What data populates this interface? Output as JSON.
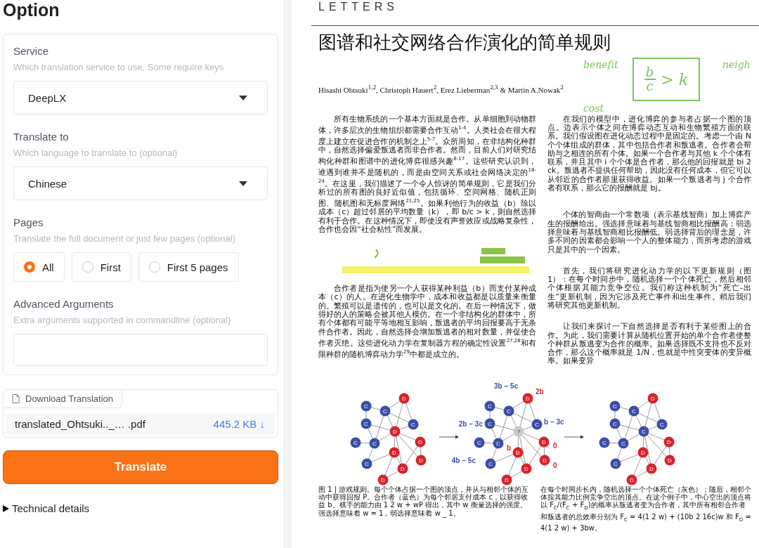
{
  "panel": {
    "title": "Option",
    "fields": [
      {
        "kind": "dropdown",
        "label": "Service",
        "hint": "Which translation service to use. Some require keys",
        "value": "DeepLX"
      },
      {
        "kind": "dropdown",
        "label": "Translate to",
        "hint": "Which language to translate to (optional)",
        "value": "Chinese"
      },
      {
        "kind": "radio",
        "label": "Pages",
        "hint": "Translate the full document or just few pages (optional)",
        "options": [
          {
            "label": "All",
            "selected": true
          },
          {
            "label": "First",
            "selected": false
          },
          {
            "label": "First 5 pages",
            "selected": false
          }
        ]
      },
      {
        "kind": "textbox",
        "label": "Advanced Arguments",
        "hint": "Extra arguments supported in commandline (optional)"
      }
    ]
  },
  "download": {
    "label": "Download Translation",
    "file_name": "translated_Ohtsuki.._… .pdf",
    "file_size": "445.2 KB",
    "download_glyph": "↓"
  },
  "translate_button": "Translate",
  "technical_details": {
    "label": "Technical details",
    "expanded": false
  },
  "document": {
    "journal_header": "LETTERS",
    "title": "图谱和社交网络合作演化的简单规则",
    "authors": "Hisashi Ohtsuki$^{1,2}$, Christoph Hauert$^{2}$, Erez Lieberman$^{2,3}$ & Martin A.Nowak$^{2}$",
    "left_column": [
      "所有生物系统的一个基本方面就是合作。从单细胞到动物群体，许多层次的生物组织都需要合作互动$^{1-4}$。人类社会在很大程度上建立在促进合作的机制之上$^{5-7}$。众所周知，在非结构化种群中，自然选择偏爱叛逃者而非合作者。然而，目前人们对研究结构化种群和图谱中的进化博弈很感兴趣$^{8-17}$。这些研究认识到，谁遇到谁并不是随机的，而是由空间关系或社会网络决定的$^{18-24}$。在这里，我们描述了一个令人惊讶的简单规则，它是我们分析过的所有图的良好近似值，包括循环、空间网格、随机正则图、随机图和无标度网络$^{21,25}$。如果利他行为的收益（b）除以成本（c）超过邻居的平均数量（k），即 b/c > k，则自然选择有利于合作。在这种情况下，即使没有声誉效应或战略复杂性，合作也会因“社会粘性”而发展。",
      "合作者是指为使另一个人获得某种利益（b）而支付某种成本（c）的人。在进化生物学中，成本和收益都是以质量来衡量的。繁殖可以是遗传的，也可以是文化的。在后一种情况下，做得好的人的策略会被其他人模仿。在一个非结构化的群体中，所有个体都有可能平等地相互影响，叛逃者的平均回报要高于无条件合作者。因此，自然选择会增加叛逃者的相对数量，并促使合作者灭绝。这些进化动力学在复制器方程的确定性设置$^{27,28}$和有限种群的随机博弈动力学$^{29}$中都是成立的。"
    ],
    "right_column": [
      "在我们的模型中，进化博弈的参与者占据一个图的顶点。边表示个体之间在博弈动态互动和生物繁殖方面的联系。我们假设图在进化动态过程中是固定的。考虑一个由 N 个个体组成的群体，其中包括合作者和叛逃者。合作者会帮助与之相连的所有个体。如果一个合作者与其他 k 个个体有联系，并且其中 i 个个体是合作者，那么他的回报就是 bi 2 ck。叛逃者不提供任何帮助，因此没有任何成本，但它可以从邻近的合作者那里获得收益。如果一个叛逃者与 j 个合作者有联系，那么它的报酬就是 bj。",
      "个体的智商由一个常数项（表示基线智商）加上博弈产生的报酬给出。强选择意味着与基线智商相比报酬高；弱选择意味着与基线智商相比报酬低。弱选择背后的理念是，许多不同的因素都会影响一个人的整体能力，而所考虑的游戏只是其中的一个因素。",
      "首先，我们将研究进化动力学的以下更新规则（图 1）：在每个时间步中，随机选择一个个体死亡，然后相邻个体根据其能力竞争空位。我们称这种机制为“死亡-出生”更新机制，因为它涉及死亡事件和出生事件。稍后我们将研究其他更新机制。",
      "让我们来探讨一下自然选择是否有利于某些图上的合作。为此，我们需要计算从随机位置开始的单个合作者使整个种群从叛逃变为合作的概率。如果选择既不支持也不反对合作，那么这个概率就是 1/N，也就是中性突变体的变异概率。如果变异"
    ],
    "handwriting": {
      "labels": [
        "benefit",
        "cost",
        "neigh"
      ],
      "numerator": "b",
      "denominator": "c",
      "relation": "> k"
    },
    "figure": {
      "graphs": [
        {
          "nodes": [
            {
              "label": "D",
              "color": "#d9232e"
            },
            {
              "label": "C",
              "color": "#3a4ea6"
            },
            {
              "label": "C",
              "color": "#3a4ea6"
            },
            {
              "label": "C",
              "color": "#3a4ea6"
            },
            {
              "label": "C",
              "color": "#3a4ea6"
            },
            {
              "label": "D",
              "color": "#d9232e"
            },
            {
              "label": "C",
              "color": "#3a4ea6"
            },
            {
              "label": "C",
              "color": "#3a4ea6"
            },
            {
              "label": "D",
              "color": "#d9232e"
            },
            {
              "label": "D",
              "color": "#d9232e"
            },
            {
              "label": "C",
              "color": "#3a4ea6"
            },
            {
              "label": "D",
              "color": "#d9232e"
            },
            {
              "label": "D",
              "color": "#d9232e"
            },
            {
              "label": "D",
              "color": "#d9232e"
            }
          ]
        },
        {
          "nodes": [
            {
              "label": "D",
              "color": "#d9232e"
            },
            {
              "label": "C",
              "color": "#3a4ea6"
            },
            {
              "label": "C",
              "color": "#3a4ea6"
            },
            {
              "label": "C",
              "color": "#3a4ea6"
            },
            {
              "label": "C",
              "color": "#3a4ea6"
            },
            {
              "label": "?",
              "color": "#c9c9c9"
            },
            {
              "label": "C",
              "color": "#3a4ea6"
            },
            {
              "label": "C",
              "color": "#3a4ea6"
            },
            {
              "label": "D",
              "color": "#d9232e"
            },
            {
              "label": "D",
              "color": "#d9232e"
            },
            {
              "label": "C",
              "color": "#3a4ea6"
            },
            {
              "label": "D",
              "color": "#d9232e"
            },
            {
              "label": "D",
              "color": "#d9232e"
            },
            {
              "label": "D",
              "color": "#d9232e"
            }
          ]
        },
        {
          "nodes": [
            {
              "label": "D",
              "color": "#d9232e"
            },
            {
              "label": "C",
              "color": "#3a4ea6"
            },
            {
              "label": "C",
              "color": "#3a4ea6"
            },
            {
              "label": "C",
              "color": "#3a4ea6"
            },
            {
              "label": "C",
              "color": "#3a4ea6"
            },
            {
              "label": "C",
              "color": "#3a4ea6"
            },
            {
              "label": "C",
              "color": "#3a4ea6"
            },
            {
              "label": "C",
              "color": "#3a4ea6"
            },
            {
              "label": "D",
              "color": "#d9232e"
            },
            {
              "label": "D",
              "color": "#d9232e"
            },
            {
              "label": "C",
              "color": "#3a4ea6"
            },
            {
              "label": "D",
              "color": "#d9232e"
            },
            {
              "label": "D",
              "color": "#d9232e"
            },
            {
              "label": "D",
              "color": "#d9232e"
            }
          ]
        }
      ],
      "annotations": [
        {
          "text": "3b − 5c",
          "color": "#3a4ea6"
        },
        {
          "text": "2b",
          "color": "#d9232e"
        },
        {
          "text": "2b − 3c",
          "color": "#3a4ea6"
        },
        {
          "text": "b − 3c",
          "color": "#3a4ea6"
        },
        {
          "text": "4b − 5c",
          "color": "#3a4ea6"
        },
        {
          "text": "b",
          "color": "#d9232e"
        },
        {
          "text": "0",
          "color": "#d9232e"
        },
        {
          "text": "0",
          "color": "#d9232e"
        }
      ]
    },
    "captions": [
      "图 1 | 游戏规则。每个个体占据一个图的顶点，并从与相邻个体的互动中获得回报 P。合作者（蓝色）为每个邻居支付成本 c，以获得收益 b。棋手的能力由 1 2 w + wP 得出，其中 w 衡量选择的强度。强选择意味着 w = 1，弱选择意味着 w _ 1。",
      "在每个时间步长内，随机选择一个个体死亡（灰色）；随后，相邻个体按其能力比例竞争空出的顶点。在这个例子中，中心空出的顶点将以 F$_{C}$/(F$_{C}$ + F$_{D}$)的概率从叛逃者变为合作者，其中所有相邻合作者和叛逃者的总效率分别为 F$_{C}$ = 4(1 2 w) + (10b 2 16c)w 和 F$_{D}$ = 4(1 2 w) + 3bw。"
    ]
  }
}
